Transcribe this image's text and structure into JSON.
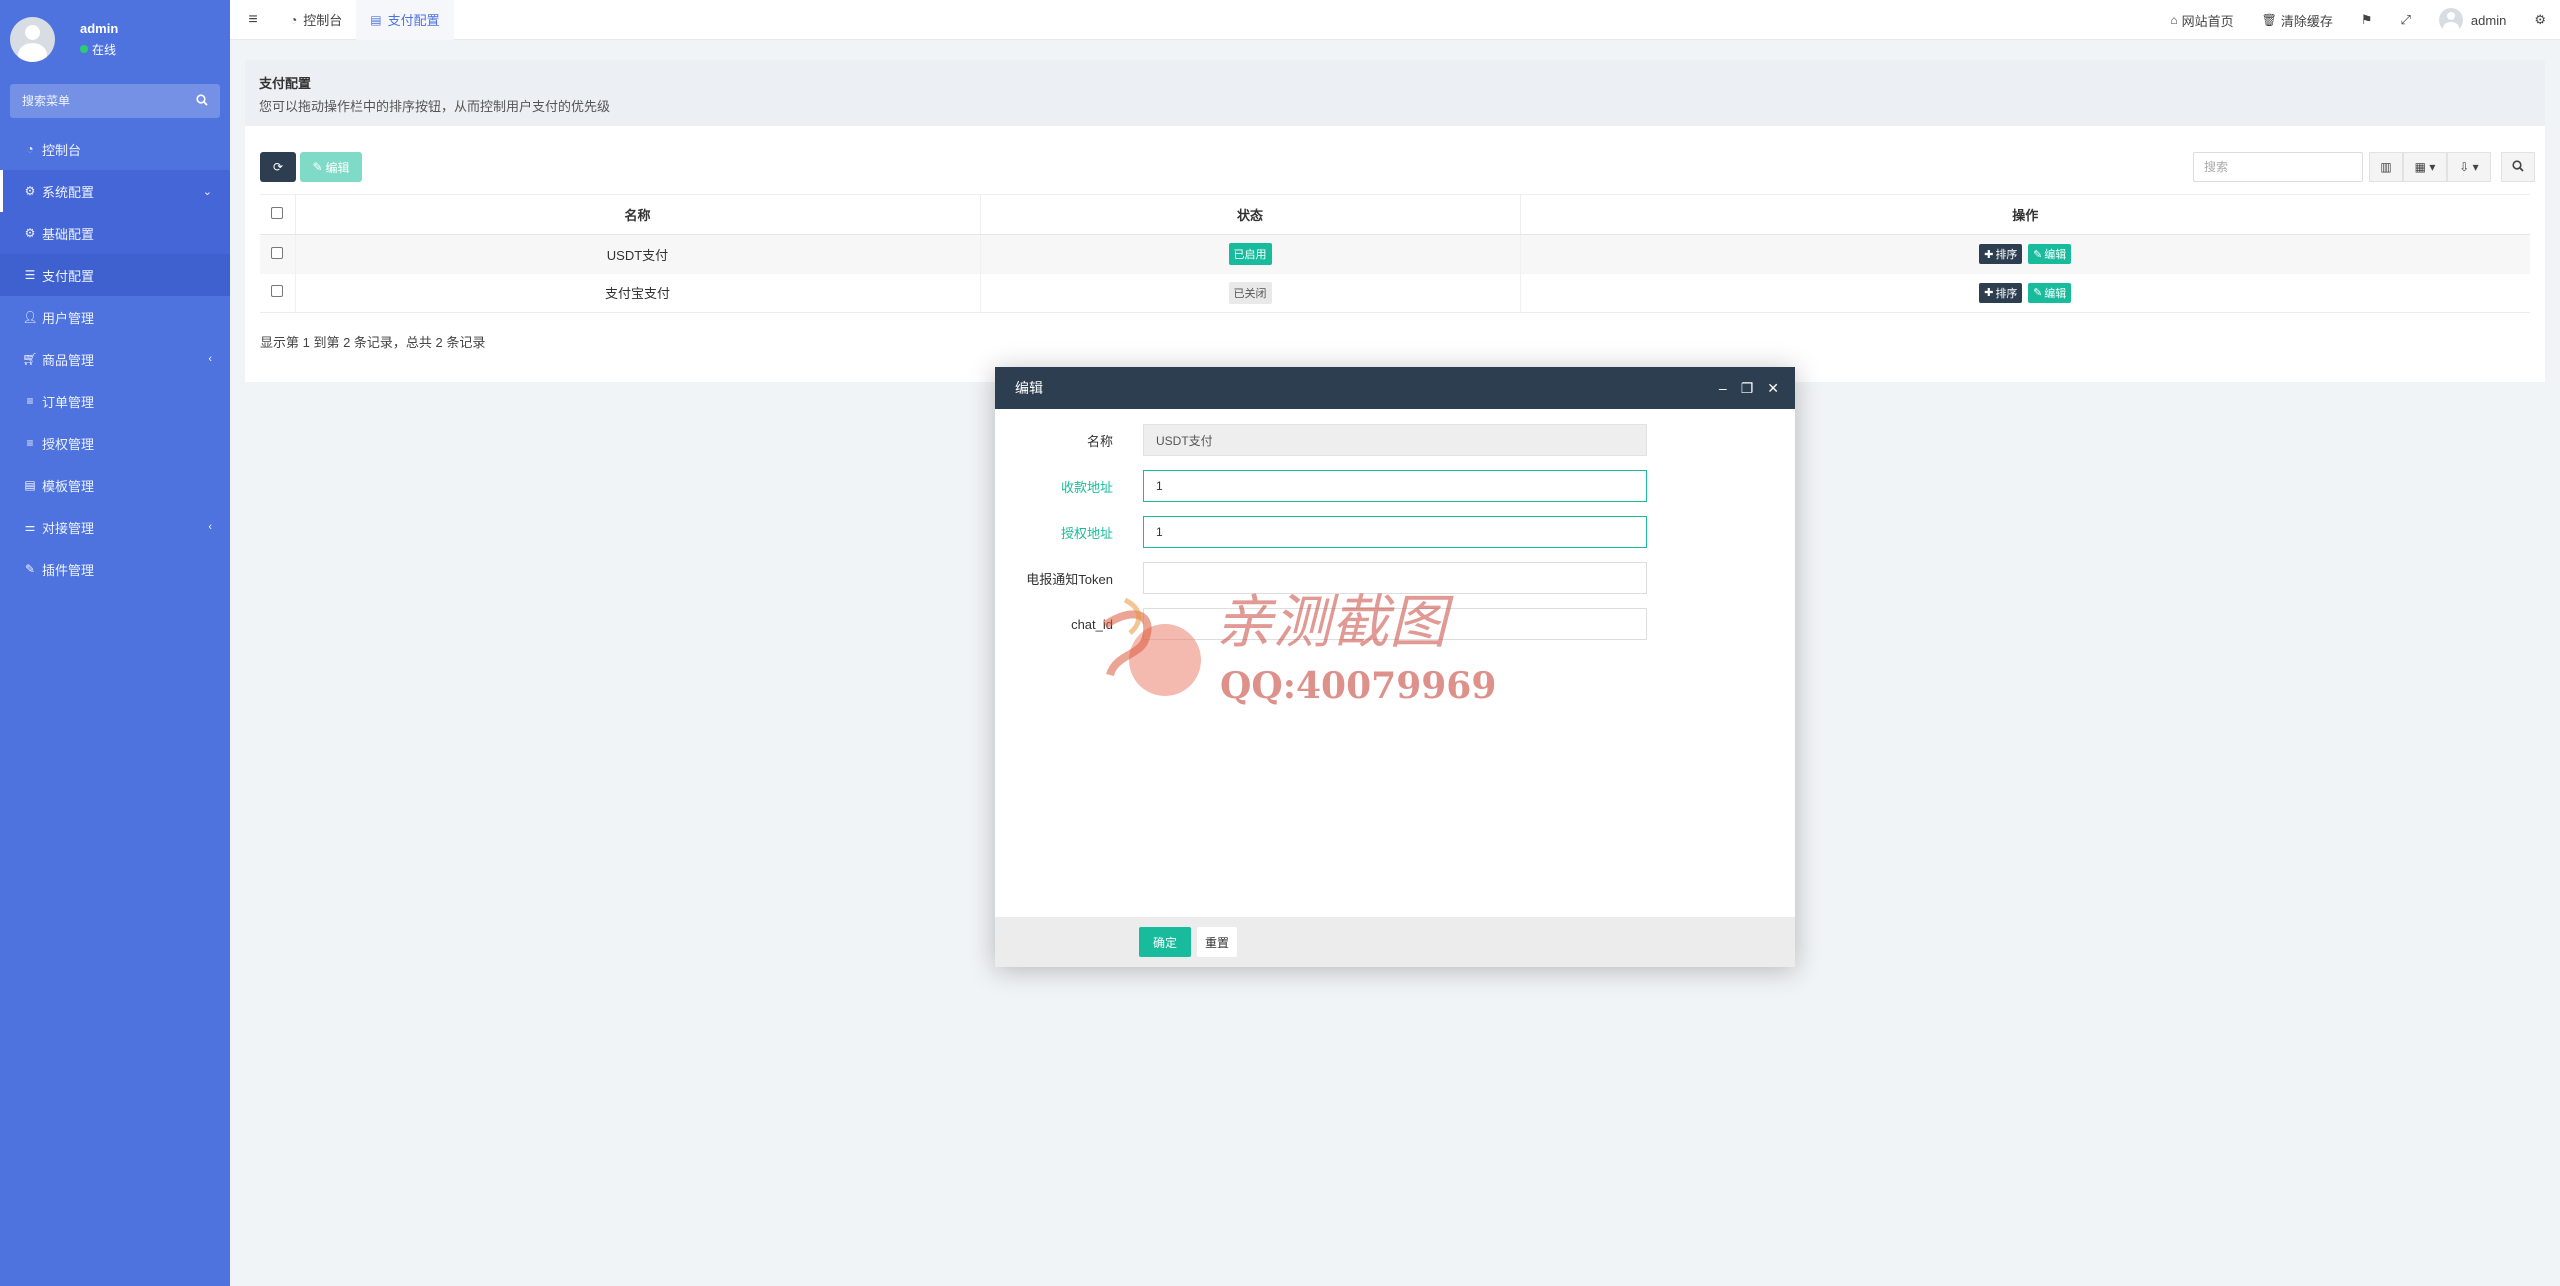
{
  "user": {
    "name": "admin",
    "status": "在线"
  },
  "sidebar": {
    "search_placeholder": "搜索菜单",
    "items": [
      {
        "label": "控制台",
        "icon": "dashboard-icon"
      },
      {
        "label": "系统配置",
        "icon": "gear-icon",
        "expanded": true
      },
      {
        "label": "基础配置",
        "icon": "gear-icon"
      },
      {
        "label": "支付配置",
        "icon": "table-icon",
        "active": true
      },
      {
        "label": "用户管理",
        "icon": "user-icon"
      },
      {
        "label": "商品管理",
        "icon": "cart-icon"
      },
      {
        "label": "订单管理",
        "icon": "list-icon"
      },
      {
        "label": "授权管理",
        "icon": "list-icon"
      },
      {
        "label": "模板管理",
        "icon": "table-icon"
      },
      {
        "label": "对接管理",
        "icon": "sliders-icon"
      },
      {
        "label": "插件管理",
        "icon": "plugin-icon"
      }
    ]
  },
  "topbar": {
    "tabs": [
      {
        "label": "控制台",
        "icon": "dashboard-icon"
      },
      {
        "label": "支付配置",
        "icon": "table-icon",
        "active": true
      }
    ],
    "links": {
      "home": "网站首页",
      "clear_cache": "清除缓存",
      "user": "admin"
    }
  },
  "page": {
    "title": "支付配置",
    "description": "您可以拖动操作栏中的排序按钮，从而控制用户支付的优先级"
  },
  "toolbar": {
    "edit_label": "编辑",
    "search_placeholder": "搜索"
  },
  "table": {
    "headers": {
      "name": "名称",
      "status": "状态",
      "actions": "操作"
    },
    "rows": [
      {
        "name": "USDT支付",
        "status": "已启用",
        "enabled": true
      },
      {
        "name": "支付宝支付",
        "status": "已关闭",
        "enabled": false
      }
    ],
    "sort_label": "排序",
    "edit_label": "编辑"
  },
  "pager": {
    "text": "显示第 1 到第 2 条记录，总共 2 条记录"
  },
  "modal": {
    "title": "编辑",
    "fields": [
      {
        "label": "名称",
        "value": "USDT支付"
      },
      {
        "label": "收款地址",
        "value": "1"
      },
      {
        "label": "授权地址",
        "value": "1"
      },
      {
        "label": "电报通知Token",
        "value": ""
      },
      {
        "label": "chat_id",
        "value": ""
      }
    ],
    "ok_label": "确定",
    "reset_label": "重置"
  },
  "watermark": {
    "line1": "亲测截图",
    "line2": "QQ:40079969"
  },
  "colors": {
    "sidebar": "#4e73df",
    "primary_dark": "#2c3e50",
    "success": "#18bc9c"
  }
}
